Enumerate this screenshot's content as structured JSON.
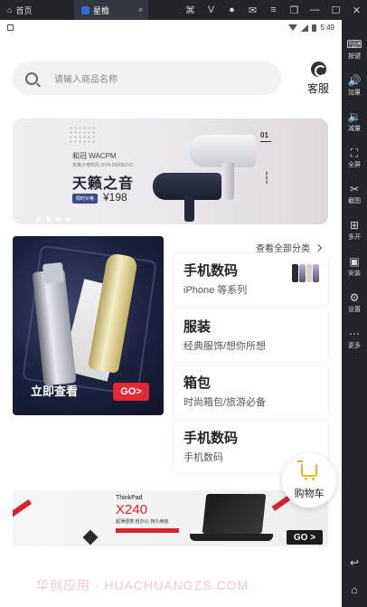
{
  "window": {
    "home_tab": "首页",
    "app_tab": "星檐",
    "close_glyph": "×"
  },
  "statusbar": {
    "time": "5:49"
  },
  "sidebar": {
    "items": [
      {
        "icon": "keyboard-icon",
        "glyph": "⌨",
        "label": "按键"
      },
      {
        "icon": "volume-up-icon",
        "glyph": "🔊",
        "label": "加量"
      },
      {
        "icon": "volume-down-icon",
        "glyph": "🔉",
        "label": "减量"
      },
      {
        "icon": "fullscreen-icon",
        "glyph": "⛶",
        "label": "全屏"
      },
      {
        "icon": "scissors-icon",
        "glyph": "✂",
        "label": "截图"
      },
      {
        "icon": "multi-open-icon",
        "glyph": "⊞",
        "label": "多开"
      },
      {
        "icon": "apk-install-icon",
        "glyph": "▣",
        "label": "安装"
      },
      {
        "icon": "settings-icon",
        "glyph": "⚙",
        "label": "设置"
      },
      {
        "icon": "more-icon",
        "glyph": "⋯",
        "label": "更多"
      }
    ],
    "nav": {
      "back": "↩",
      "home": "⌂"
    }
  },
  "search": {
    "placeholder": "请输入商品名称"
  },
  "service": {
    "label": "客服"
  },
  "banner": {
    "brand": "和冠 WACPM",
    "model": "负离子电吹风 DYH-2600ED-C",
    "title": "天籁之音",
    "badge": "限时价格",
    "price": "¥198",
    "index": "01",
    "slide_count": 4
  },
  "promo": {
    "label": "立即查看",
    "go": "GO>"
  },
  "categories": {
    "view_all": "查看全部分类",
    "items": [
      {
        "title": "手机数码",
        "subtitle": "iPhone 等系列"
      },
      {
        "title": "服装",
        "subtitle": "经典服饰/想你所想"
      },
      {
        "title": "箱包",
        "subtitle": "时尚箱包/旅游必备"
      },
      {
        "title": "手机数码",
        "subtitle": "手机数码"
      }
    ]
  },
  "thinkpad": {
    "brand": "ThinkPad",
    "model": "X240",
    "desc": "超薄便携·轻办公·持久续航",
    "go": "GO >"
  },
  "cart": {
    "label": "购物车"
  },
  "watermark": "华创应用 · HUACHUANGZS.COM",
  "colors": {
    "accent_red": "#e02932",
    "cart_yellow": "#e6b820",
    "emulator_dark": "#23252b"
  }
}
